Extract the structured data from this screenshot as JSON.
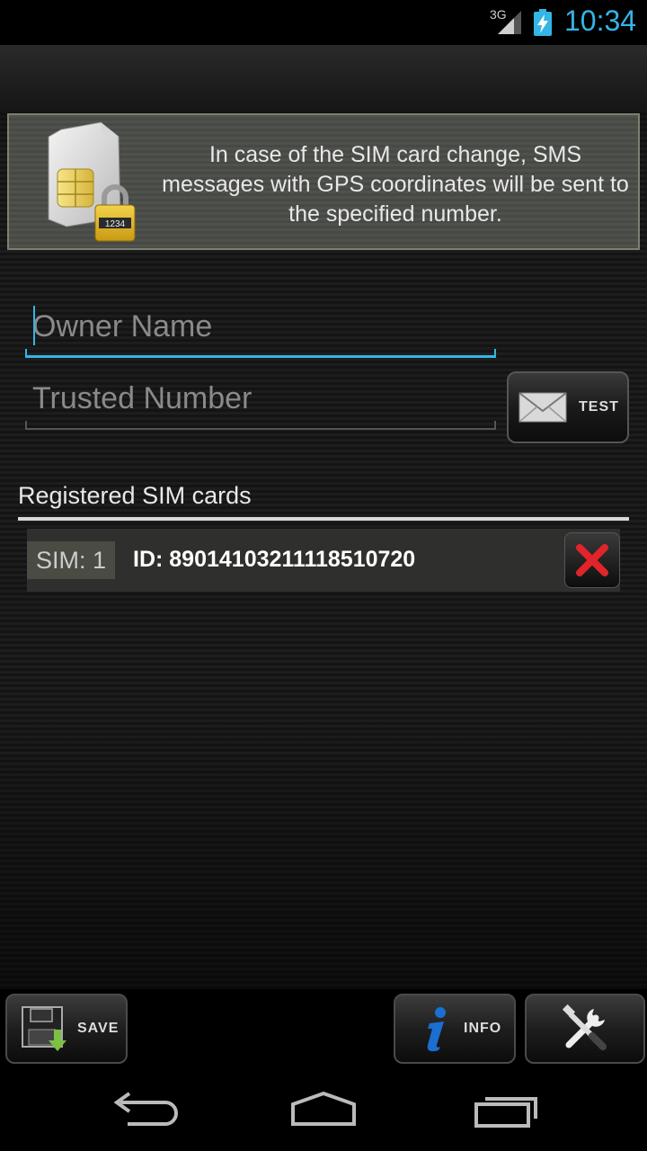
{
  "status_bar": {
    "network": "3G",
    "time": "10:34",
    "clock_color": "#33b5e5"
  },
  "info_panel": {
    "message": "In case of the SIM card change, SMS messages with GPS coordinates will be sent to the specified number.",
    "lock_code": "1234",
    "icon": "sim-card-lock-icon"
  },
  "form": {
    "owner_name_placeholder": "Owner Name",
    "owner_name_value": "",
    "trusted_number_placeholder": "Trusted Number",
    "trusted_number_value": "",
    "test_button_label": "TEST",
    "test_icon": "envelope-icon"
  },
  "registered": {
    "title": "Registered SIM cards",
    "items": [
      {
        "tag": "SIM: 1",
        "id": "ID: 89014103211118510720"
      }
    ]
  },
  "actions": {
    "save_label": "SAVE",
    "info_label": "INFO",
    "tools_icon": "tools-icon"
  },
  "navigation": {
    "back_icon": "back-icon",
    "home_icon": "home-icon",
    "recents_icon": "recents-icon"
  },
  "colors": {
    "accent": "#33b5e5",
    "delete": "#e0242a",
    "save_arrow": "#7bc142",
    "info_blue": "#1a6fd0"
  }
}
